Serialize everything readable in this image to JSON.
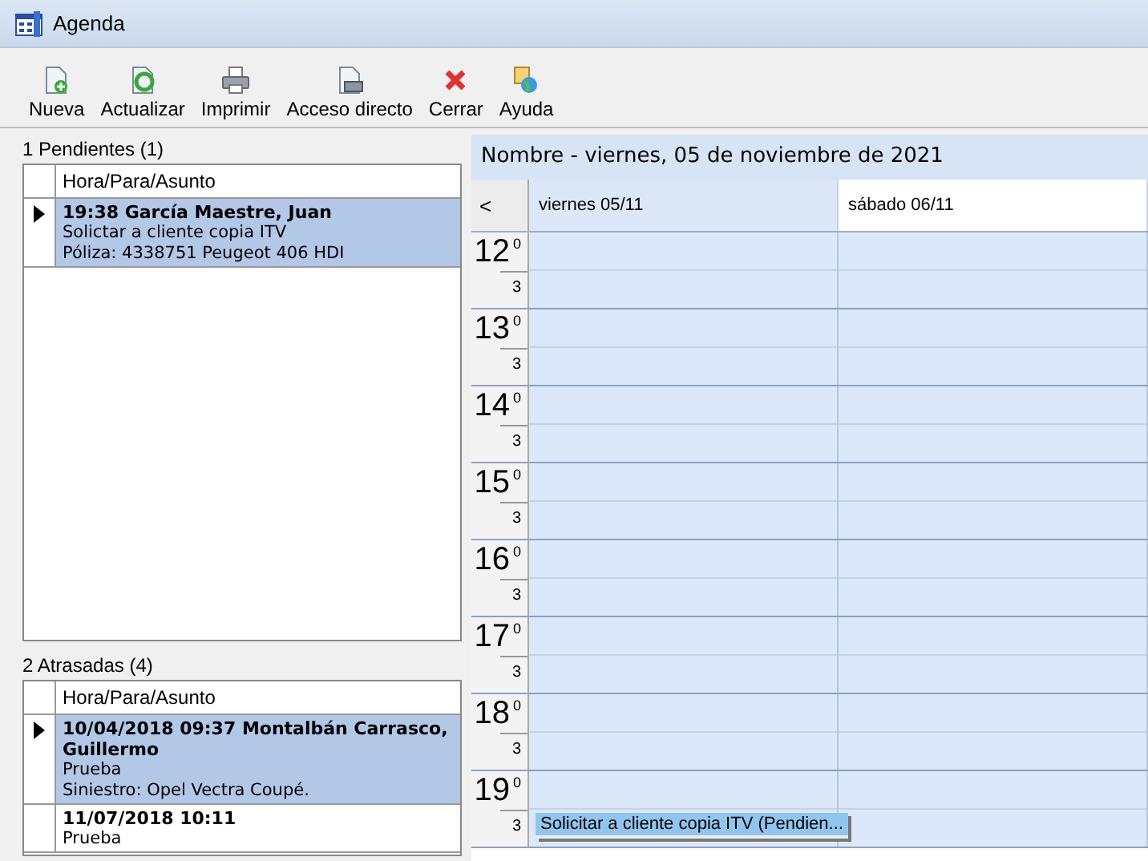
{
  "window": {
    "title": "Agenda"
  },
  "toolbar": [
    {
      "label": "Nueva",
      "kind": "new"
    },
    {
      "label": "Actualizar",
      "kind": "refresh"
    },
    {
      "label": "Imprimir",
      "kind": "print"
    },
    {
      "label": "Acceso directo",
      "kind": "shortcut"
    },
    {
      "label": "Cerrar",
      "kind": "close"
    },
    {
      "label": "Ayuda",
      "kind": "help"
    }
  ],
  "pending": {
    "title": "1 Pendientes (1)",
    "column": "Hora/Para/Asunto",
    "rows": [
      {
        "selected": true,
        "heading": "19:38 García Maestre, Juan",
        "lines": [
          "Solictar a cliente copia ITV",
          "Póliza: 4338751 Peugeot 406 HDI"
        ]
      }
    ]
  },
  "overdue": {
    "title": "2 Atrasadas (4)",
    "column": "Hora/Para/Asunto",
    "rows": [
      {
        "selected": true,
        "heading": "10/04/2018 09:37 Montalbán Carrasco, Guillermo",
        "lines": [
          "Prueba",
          "Siniestro:  Opel Vectra Coupé."
        ]
      },
      {
        "selected": false,
        "heading": "11/07/2018 10:11",
        "lines": [
          "Prueba"
        ]
      }
    ]
  },
  "calendar": {
    "title": "Nombre - viernes, 05 de noviembre de 2021",
    "prev": "<",
    "days": [
      {
        "label": "viernes 05/11",
        "selected": true
      },
      {
        "label": "sábado 06/11",
        "selected": false
      }
    ],
    "hours": [
      {
        "hour": "12",
        "half": "3",
        "minute": "0"
      },
      {
        "hour": "13",
        "half": "3",
        "minute": "0"
      },
      {
        "hour": "14",
        "half": "3",
        "minute": "0"
      },
      {
        "hour": "15",
        "half": "3",
        "minute": "0"
      },
      {
        "hour": "16",
        "half": "3",
        "minute": "0"
      },
      {
        "hour": "17",
        "half": "3",
        "minute": "0"
      },
      {
        "hour": "18",
        "half": "3",
        "minute": "0"
      },
      {
        "hour": "19",
        "half": "3",
        "minute": "0",
        "appointments": [
          "Solicitar a cliente copia ITV (Pendien..."
        ]
      }
    ]
  }
}
